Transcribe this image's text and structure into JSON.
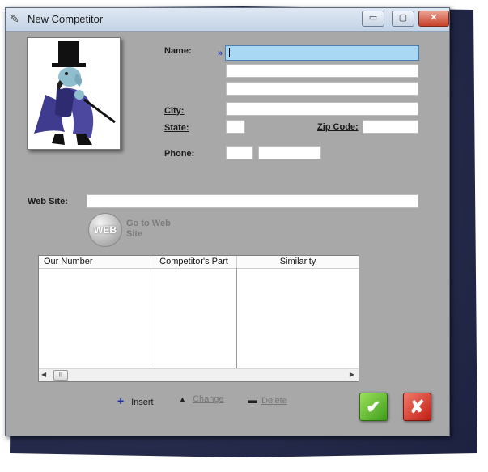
{
  "window": {
    "title": "New Competitor",
    "icon": "quill-icon",
    "controls": {
      "minimize": "▭",
      "maximize": "▢",
      "close": "✕"
    }
  },
  "form": {
    "name_label": "Name:",
    "name_marker": "»",
    "city_label": "City:",
    "state_label": "State:",
    "zip_label": "Zip Code:",
    "phone_label": "Phone:",
    "website_label": "Web Site:",
    "name_line1": "",
    "name_line2": "",
    "name_line3": "",
    "city": "",
    "state": "",
    "zip": "",
    "phone_area": "",
    "phone_number": "",
    "website": ""
  },
  "web_button": {
    "icon_text": "WEB",
    "label": "Go to Web Site"
  },
  "grid": {
    "columns": [
      "Our Number",
      "Competitor's Part",
      "Similarity"
    ],
    "rows": [],
    "scroll_thumb": "|||"
  },
  "actions": {
    "insert": {
      "label": "Insert",
      "icon": "+"
    },
    "change": {
      "label": "Change",
      "icon": "▲"
    },
    "delete": {
      "label": "Delete",
      "icon": "▬"
    }
  },
  "buttons": {
    "ok": "✔",
    "cancel": "✘"
  },
  "colors": {
    "focused_field": "#a9d8f4",
    "form_background": "#a9a9a9",
    "ok_green": "#4caf1e",
    "cancel_red": "#d32a1e"
  }
}
